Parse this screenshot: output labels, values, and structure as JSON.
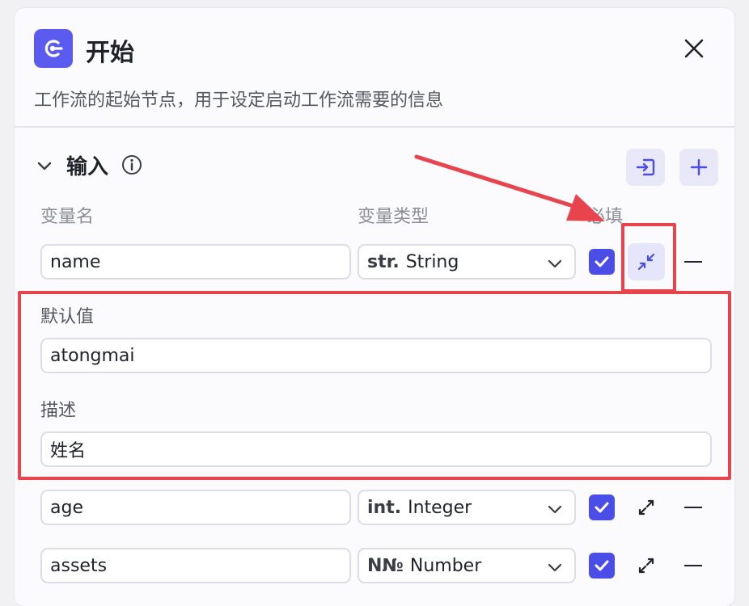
{
  "header": {
    "title": "开始",
    "description": "工作流的起始节点，用于设定启动工作流需要的信息"
  },
  "section": {
    "title": "输入"
  },
  "columns": {
    "name": "变量名",
    "type": "变量类型",
    "required": "必填"
  },
  "rows": [
    {
      "name": "name",
      "type_prefix": "str.",
      "type": "String",
      "required": true,
      "expanded": true,
      "default_label": "默认值",
      "default_value": "atongmai",
      "desc_label": "描述",
      "desc_value": "姓名"
    },
    {
      "name": "age",
      "type_prefix": "int.",
      "type": "Integer",
      "required": true,
      "expanded": false
    },
    {
      "name": "assets",
      "type_prefix": "N№",
      "type": "Number",
      "required": true,
      "expanded": false
    }
  ],
  "colors": {
    "accent": "#4b4ee6",
    "node_icon": "#5b5bf0",
    "highlight": "#e8444d"
  },
  "icons": [
    "node-start-icon",
    "close-icon",
    "chevron-down-icon",
    "info-icon",
    "import-icon",
    "plus-icon",
    "checkmark-icon",
    "collapse-icon",
    "expand-icon",
    "minus-icon"
  ]
}
